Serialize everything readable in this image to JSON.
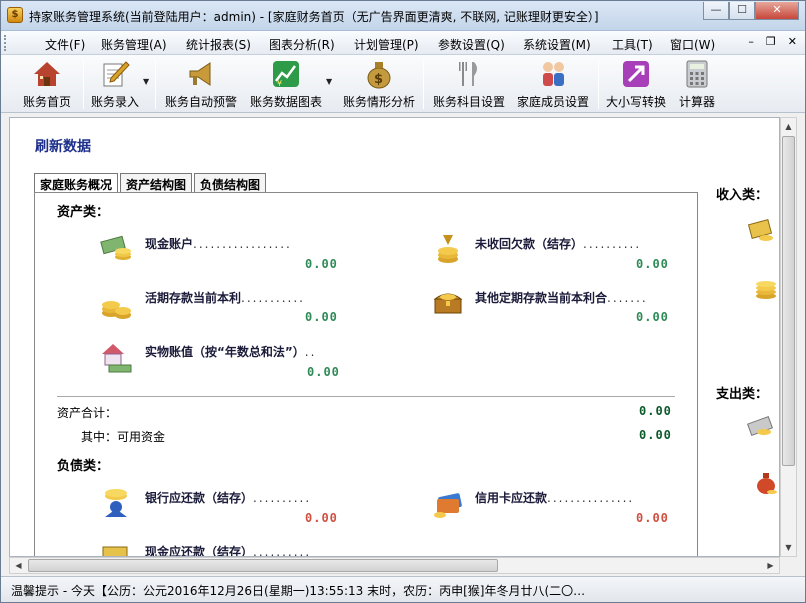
{
  "window": {
    "title": "持家账务管理系统(当前登陆用户：admin) - [家庭财务首页（无广告界面更清爽, 不联网, 记账理财更安全）]",
    "app_icon_glyph": "$",
    "minimize": "—",
    "maximize": "☐",
    "close": "✕"
  },
  "menu": {
    "items": [
      "文件(F)",
      "账务管理(A)",
      "统计报表(S)",
      "图表分析(R)",
      "计划管理(P)",
      "参数设置(Q)",
      "系统设置(M)",
      "工具(T)",
      "窗口(W)"
    ],
    "mdi_minimize": "–",
    "mdi_restore": "❐",
    "mdi_close": "✕"
  },
  "toolbar": {
    "buttons": [
      {
        "label": "账务首页",
        "icon": "house-icon",
        "color": "#b8442f"
      },
      {
        "label": "账务录入",
        "icon": "pencil-notebook-icon",
        "color": "#d8a227"
      },
      {
        "label": "账务自动预警",
        "icon": "megaphone-icon",
        "color": "#c99a3a"
      },
      {
        "label": "账务数据图表",
        "icon": "chart-icon",
        "color": "#2d9b48"
      },
      {
        "label": "账务情形分析",
        "icon": "money-bag-icon",
        "color": "#c39a3d"
      },
      {
        "label": "账务科目设置",
        "icon": "fork-knife-icon",
        "color": "#8a8a8a"
      },
      {
        "label": "家庭成员设置",
        "icon": "family-icon",
        "color": "#cf4a4a"
      },
      {
        "label": "大小写转换",
        "icon": "convert-icon",
        "color": "#a63fb8"
      },
      {
        "label": "计算器",
        "icon": "calculator-icon",
        "color": "#9aa1a8"
      }
    ]
  },
  "main": {
    "refresh_label": "刷新数据",
    "tabs": [
      "家庭账务概况",
      "资产结构图",
      "负债结构图"
    ],
    "assets": {
      "title": "资产类：",
      "items": [
        {
          "label": "现金账户",
          "value": "0.00"
        },
        {
          "label": "未收回欠款（结存）",
          "value": "0.00"
        },
        {
          "label": "活期存款当前本利",
          "value": "0.00"
        },
        {
          "label": "其他定期存款当前本利合",
          "value": "0.00"
        },
        {
          "label": "实物账值（按“年数总和法”）",
          "value": "0.00"
        }
      ],
      "total_label": "资产合计：",
      "total_value": "0.00",
      "available_label": "其中：可用资金",
      "available_value": "0.00"
    },
    "liabilities": {
      "title": "负债类：",
      "items": [
        {
          "label": "银行应还款（结存）",
          "value": "0.00"
        },
        {
          "label": "信用卡应还款",
          "value": "0.00"
        },
        {
          "label": "现金应还款（结存）",
          "value": ""
        }
      ]
    },
    "side": {
      "income_title": "收入类：",
      "expense_title": "支出类："
    }
  },
  "status": {
    "text": "温馨提示 - 今天【公历：公元2016年12月26日(星期一)13:55:13 末时，农历：丙申[猴]年冬月廿八(二〇…"
  }
}
